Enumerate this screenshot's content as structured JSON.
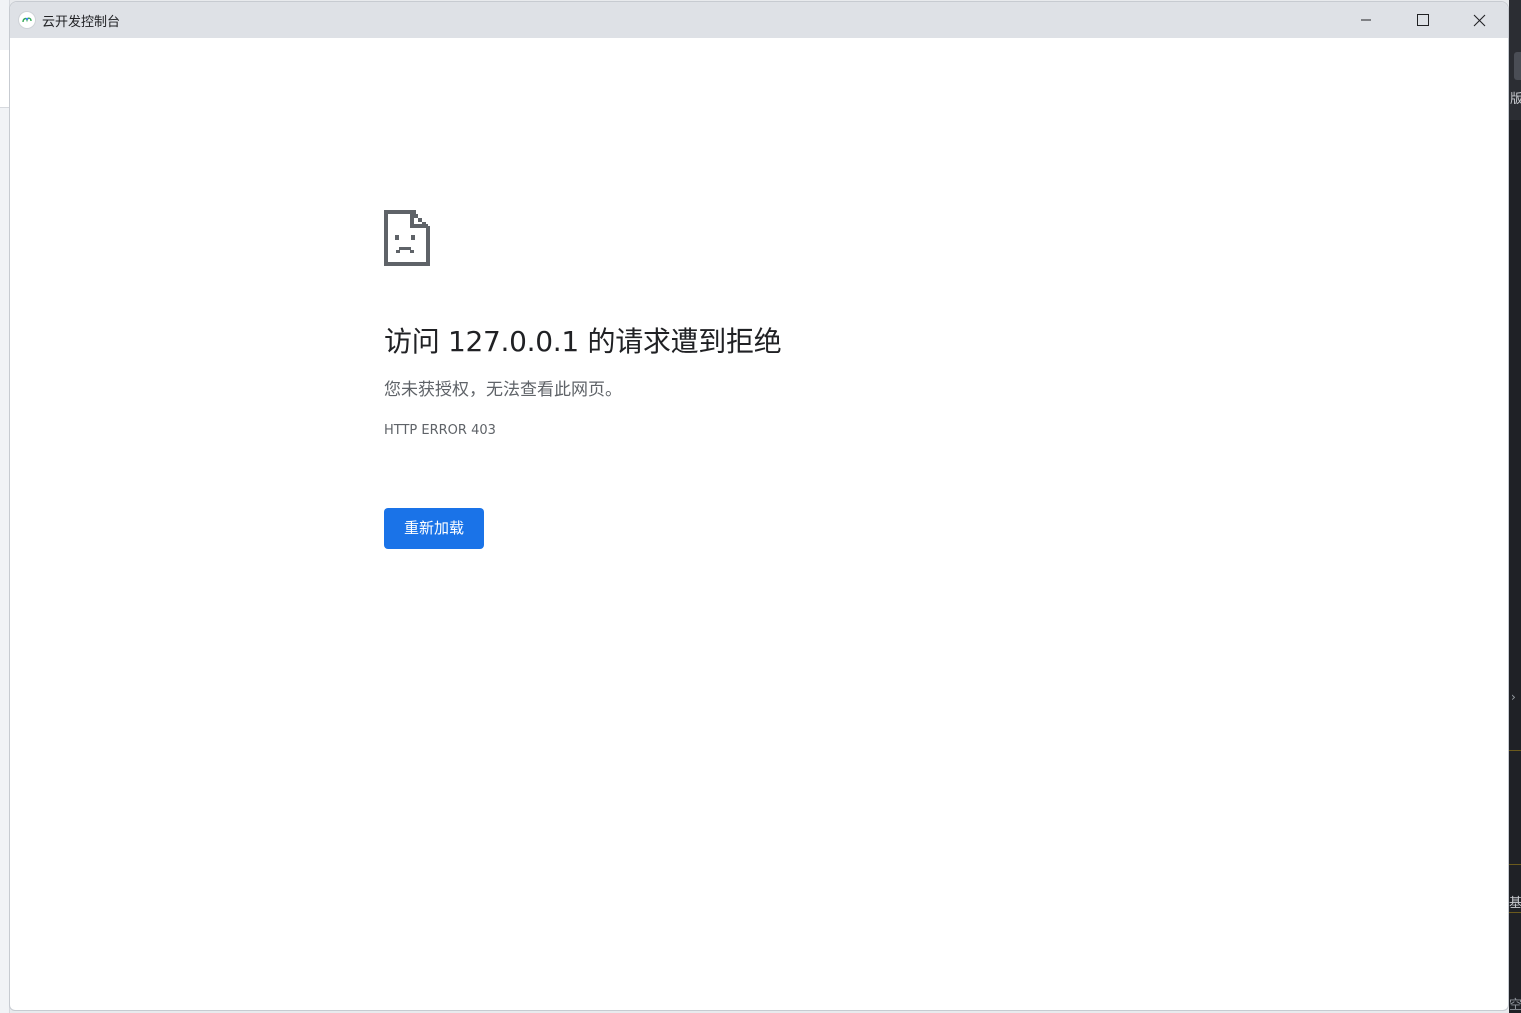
{
  "window": {
    "title": "云开发控制台",
    "app_icon": "cloudbase-app-icon",
    "controls": {
      "minimize_icon": "minimize-icon",
      "maximize_icon": "maximize-icon",
      "close_icon": "close-icon"
    }
  },
  "error_page": {
    "icon": "sad-page-icon",
    "title": "访问 127.0.0.1 的请求遭到拒绝",
    "description": "您未获授权，无法查看此网页。",
    "error_code": "HTTP ERROR 403",
    "reload_button_label": "重新加载",
    "accent_color": "#1a73e8"
  },
  "background_app": {
    "right_edge_texts": [
      "版",
      "基",
      "空"
    ]
  }
}
